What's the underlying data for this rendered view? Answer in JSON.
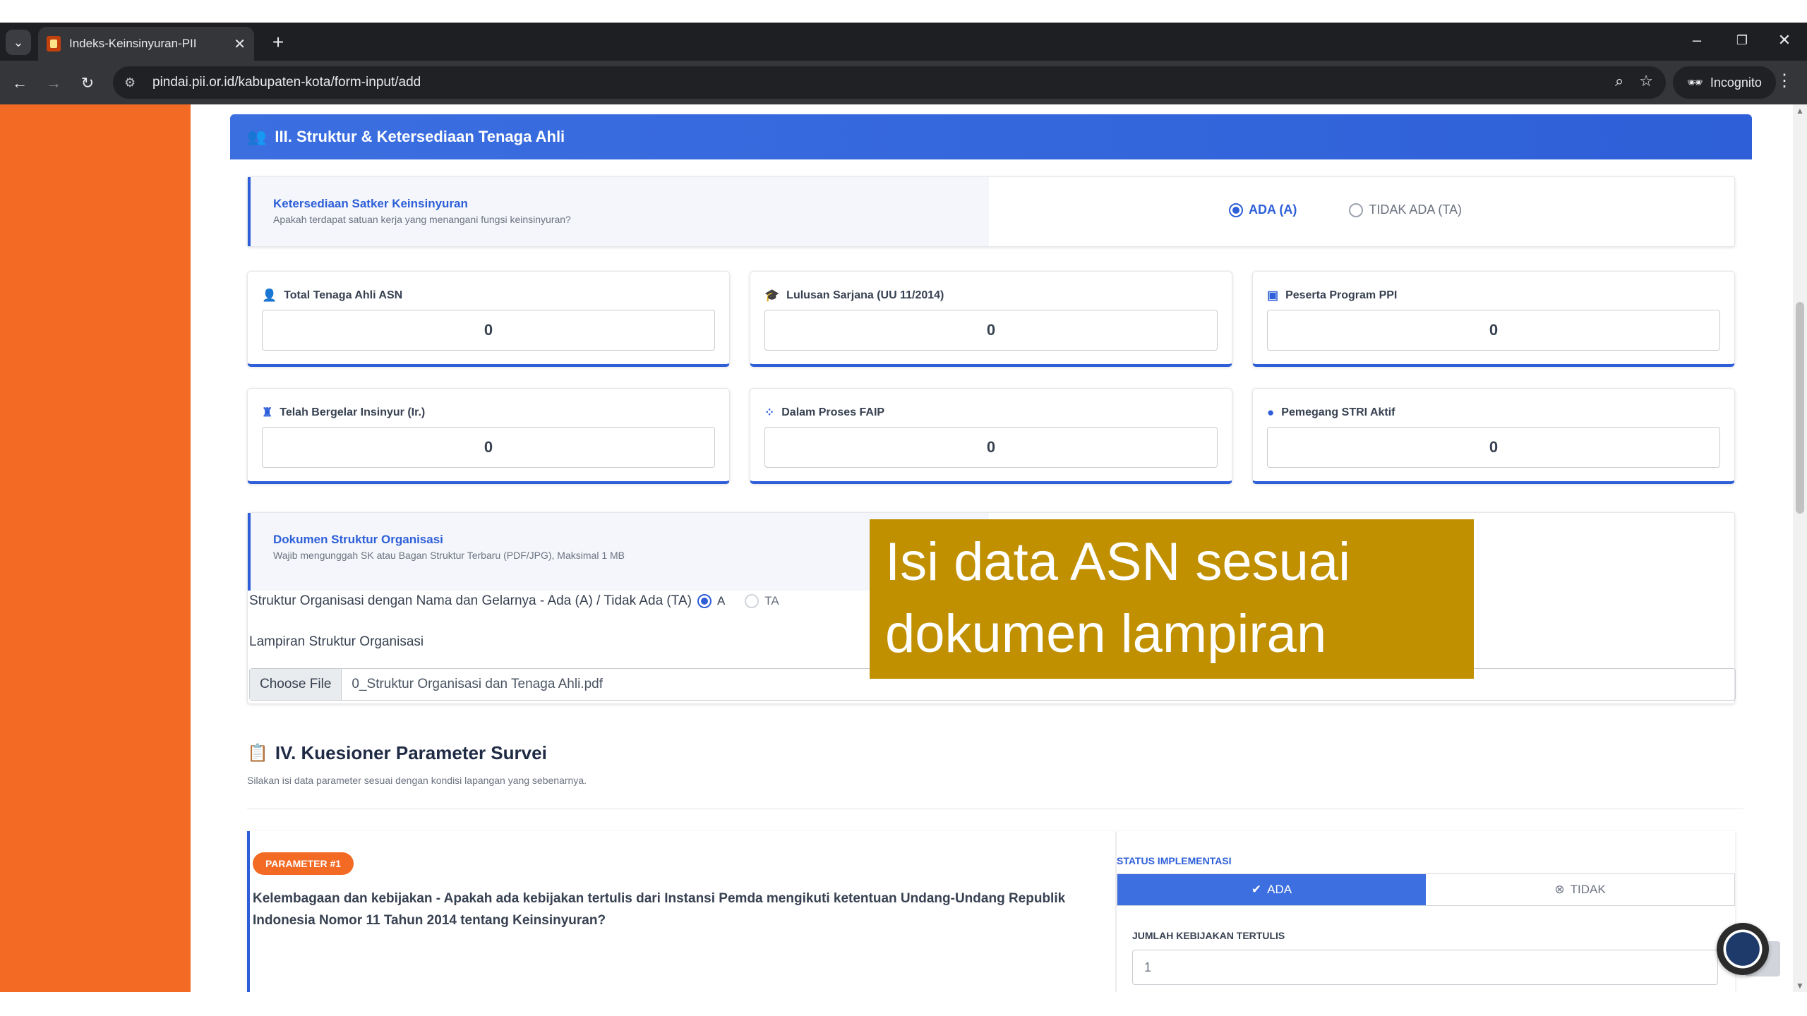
{
  "browser": {
    "tab_title": "Indeks-Keinsinyuran-PII",
    "url": "pindai.pii.or.id/kabupaten-kota/form-input/add",
    "incognito_label": "Incognito"
  },
  "section3": {
    "title": "III. Struktur & Ketersediaan Tenaga Ahli",
    "satker": {
      "title": "Ketersediaan Satker Keinsinyuran",
      "subtitle": "Apakah terdapat satuan kerja yang menangani fungsi keinsinyuran?",
      "option_yes": "ADA (A)",
      "option_no": "TIDAK ADA (TA)",
      "selected": "ADA (A)"
    },
    "stats": [
      {
        "label": "Total Tenaga Ahli ASN",
        "value": "0",
        "icon": "users-icon"
      },
      {
        "label": "Lulusan Sarjana (UU 11/2014)",
        "value": "0",
        "icon": "graduation-cap-icon"
      },
      {
        "label": "Peserta Program PPI",
        "value": "0",
        "icon": "presentation-icon"
      },
      {
        "label": "Telah Bergelar Insinyur (Ir.)",
        "value": "0",
        "icon": "user-tie-icon"
      },
      {
        "label": "Dalam Proses FAIP",
        "value": "0",
        "icon": "spinner-icon"
      },
      {
        "label": "Pemegang STRI Aktif",
        "value": "0",
        "icon": "badge-icon"
      }
    ],
    "dokumen": {
      "title": "Dokumen Struktur Organisasi",
      "subtitle": "Wajib mengunggah SK atau Bagan Struktur Terbaru (PDF/JPG), Maksimal 1 MB",
      "question": "Struktur Organisasi dengan Nama dan Gelarnya - Ada (A) / Tidak Ada (TA)",
      "option_a": "A",
      "option_ta": "TA",
      "lampiran_label": "Lampiran Struktur Organisasi",
      "file_button": "Choose File",
      "file_name": "0_Struktur Organisasi dan Tenaga Ahli.pdf"
    }
  },
  "overlay": {
    "line1": "Isi data ASN sesuai",
    "line2": "dokumen lampiran"
  },
  "section4": {
    "title": "IV. Kuesioner Parameter Survei",
    "subtitle": "Silakan isi data parameter sesuai dengan kondisi lapangan yang sebenarnya.",
    "parameter": {
      "badge": "PARAMETER #1",
      "question": "Kelembagaan dan kebijakan - Apakah ada kebijakan tertulis dari Instansi Pemda mengikuti ketentuan Undang-Undang Republik Indonesia Nomor 11 Tahun 2014 tentang Keinsinyuran?",
      "status_label": "STATUS IMPLEMENTASI",
      "option_ada": "ADA",
      "option_tidak": "TIDAK",
      "count_label": "JUMLAH KEBIJAKAN TERTULIS",
      "count_value": "1"
    }
  },
  "colors": {
    "accent": "#2e5fd8",
    "sidebar": "#f36a24",
    "overlay": "#c09000"
  }
}
